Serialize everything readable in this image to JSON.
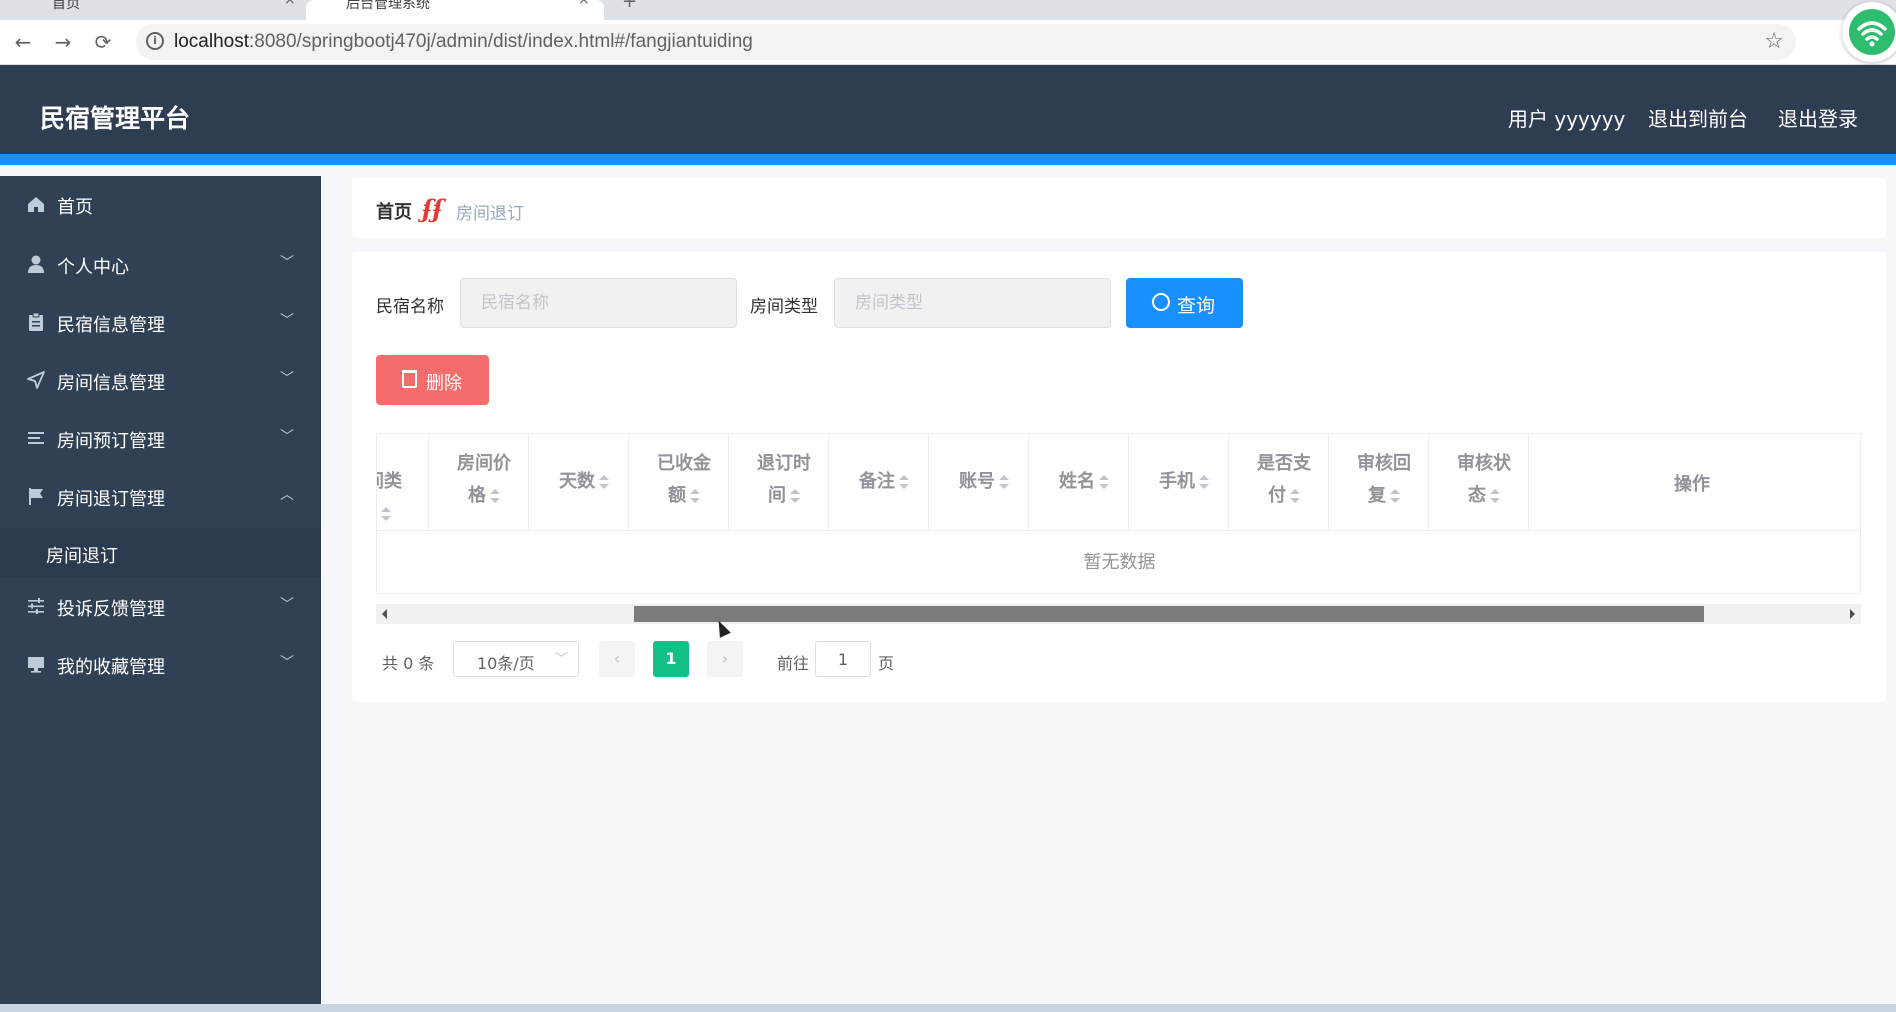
{
  "browser": {
    "tabs": [
      {
        "title": "首页",
        "close": "×"
      },
      {
        "title": "后台管理系统",
        "close": "×"
      }
    ],
    "new_tab": "+",
    "nav": {
      "back": "←",
      "forward": "→",
      "reload": "⟳"
    },
    "info_icon": "i",
    "url_host": "localhost",
    "url_path": ":8080/springbootj470j/admin/dist/index.html#/fangjiantuiding",
    "bookmark": "☆"
  },
  "header": {
    "title": "民宿管理平台",
    "user": "用户 yyyyyy",
    "to_front": "退出到前台",
    "logout": "退出登录",
    "accent_color": "#1890ff"
  },
  "sidebar": {
    "items": [
      {
        "label": "首页",
        "icon": "home-icon",
        "arrow": ""
      },
      {
        "label": "个人中心",
        "icon": "user-icon",
        "arrow": "﹀"
      },
      {
        "label": "民宿信息管理",
        "icon": "clipboard-icon",
        "arrow": "﹀"
      },
      {
        "label": "房间信息管理",
        "icon": "send-icon",
        "arrow": "﹀"
      },
      {
        "label": "房间预订管理",
        "icon": "list-icon",
        "arrow": "﹀"
      },
      {
        "label": "房间退订管理",
        "icon": "flag-icon",
        "arrow": "︿"
      },
      {
        "label": "投诉反馈管理",
        "icon": "sliders-icon",
        "arrow": "﹀"
      },
      {
        "label": "我的收藏管理",
        "icon": "monitor-icon",
        "arrow": "﹀"
      }
    ],
    "subitem": "房间退订"
  },
  "breadcrumb": {
    "home": "首页",
    "separator": "ʄʄ",
    "current": "房间退订"
  },
  "search": {
    "label1": "民宿名称",
    "placeholder1": "民宿名称",
    "label2": "房间类型",
    "placeholder2": "房间类型",
    "button": "查询"
  },
  "actions": {
    "delete": "删除"
  },
  "table": {
    "columns": [
      {
        "l1": "间类",
        "l2": ""
      },
      {
        "l1": "房间价",
        "l2": "格"
      },
      {
        "l1": "天数",
        "l2": ""
      },
      {
        "l1": "已收金",
        "l2": "额"
      },
      {
        "l1": "退订时",
        "l2": "间"
      },
      {
        "l1": "备注",
        "l2": ""
      },
      {
        "l1": "账号",
        "l2": ""
      },
      {
        "l1": "姓名",
        "l2": ""
      },
      {
        "l1": "手机",
        "l2": ""
      },
      {
        "l1": "是否支",
        "l2": "付"
      },
      {
        "l1": "审核回",
        "l2": "复"
      },
      {
        "l1": "审核状",
        "l2": "态"
      }
    ],
    "ops": "操作",
    "empty": "暂无数据"
  },
  "pagination": {
    "total": "共 0 条",
    "page_size": "10条/页",
    "prev": "‹",
    "current": "1",
    "next": "›",
    "goto": "前往",
    "jump_value": "1",
    "page": "页"
  }
}
